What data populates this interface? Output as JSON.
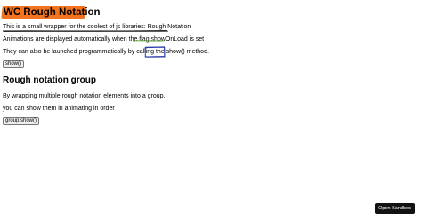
{
  "header": {
    "title": "WC Rough Notation",
    "highlight_color": "#f4731f"
  },
  "intro": {
    "line1": "This is a small wrapper for the coolest of js libraries: Rough Notation",
    "line2_prefix": "Animations are displayed automatically when the flag ",
    "line2_flag": "showOnLoad",
    "line2_suffix": " is set",
    "line3_prefix": "They can also be launched programmatically by calling the ",
    "line3_code": "show()",
    "line3_suffix": " method.",
    "show_button_label": "show()",
    "underline_color": "#000000",
    "flag_underline_color": "#5aa832",
    "box_color": "#2b3ea8"
  },
  "group": {
    "heading": "Rough notation group",
    "line1": "By wrapping multiple rough notation elements into a group,",
    "line2": "you can show them in animating in order",
    "button_label": "group.show()"
  },
  "sandbox": {
    "button_label": "Open Sandbox"
  }
}
